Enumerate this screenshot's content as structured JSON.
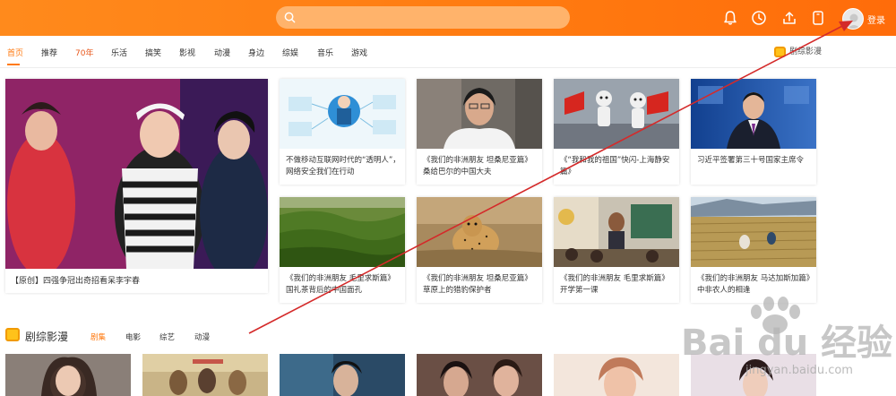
{
  "header": {
    "search_placeholder": "",
    "login_label": "登录",
    "icons": [
      "search-icon",
      "bell-icon",
      "clock-icon",
      "upload-icon",
      "tablet-icon",
      "avatar"
    ],
    "brand_color": "#ff7a10"
  },
  "nav": {
    "items": [
      "首页",
      "推荐",
      "70年",
      "乐活",
      "搞笑",
      "影视",
      "动漫",
      "身边",
      "综娱",
      "音乐",
      "游戏"
    ],
    "active": "首页",
    "right_label": "剧综影漫"
  },
  "feature": {
    "caption": "【原创】四强争冠出奇招看呆李宇春"
  },
  "cards": [
    {
      "title": "不做移动互联网时代的“透明人”，网络安全我们在行动"
    },
    {
      "title": "《我们的非洲朋友 坦桑尼亚篇》桑给巴尔的中国大夫"
    },
    {
      "title": "《“我和我的祖国”快闪-上海静安篇》"
    },
    {
      "title": "习近平签署第三十号国家主席令"
    },
    {
      "title": "《我们的非洲朋友 毛里求斯篇》国礼茶背后的中国面孔"
    },
    {
      "title": "《我们的非洲朋友 坦桑尼亚篇》草原上的猎豹保护者"
    },
    {
      "title": "《我们的非洲朋友 毛里求斯篇》开学第一课"
    },
    {
      "title": "《我们的非洲朋友 马达加斯加篇》中非农人的相逢"
    }
  ],
  "section2": {
    "title": "剧综影漫",
    "tabs": [
      "剧集",
      "电影",
      "综艺",
      "动漫"
    ],
    "active_tab": "剧集"
  },
  "watermark": {
    "logo_text": "Bai du 经验",
    "url": "jingyan.baidu.com"
  }
}
